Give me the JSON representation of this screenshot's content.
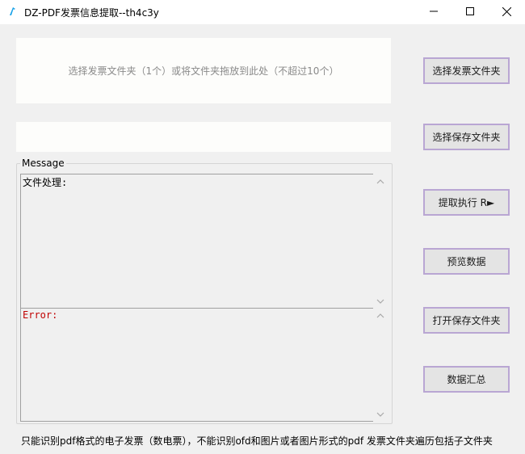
{
  "window": {
    "title": "DZ-PDF发票信息提取--th4c3y",
    "minimize_glyph": "—",
    "maximize_glyph": "☐",
    "close_glyph": "✕"
  },
  "drop_zone": {
    "text": "选择发票文件夹（1个）或将文件夹拖放到此处（不超过10个）"
  },
  "save_path": {
    "value": ""
  },
  "buttons": {
    "select_invoice_folder": "选择发票文件夹",
    "select_save_folder": "选择保存文件夹",
    "extract_run": "提取执行 R►",
    "preview_data": "预览数据",
    "open_save_folder": "打开保存文件夹",
    "data_summary": "数据汇总"
  },
  "message_group": {
    "legend": "Message",
    "file_log": "文件处理:",
    "error_log": "Error:"
  },
  "footer": {
    "text": "只能识别pdf格式的电子发票（数电票），不能识别ofd和图片或者图片形式的pdf    发票文件夹遍历包括子文件夹"
  },
  "colors": {
    "button_border": "#b9a6d3",
    "error_text": "#c00000",
    "app_icon": "#1aa3e8"
  },
  "icons": {
    "app": "app-icon",
    "scroll_up": "chevron-up-icon",
    "scroll_down": "chevron-down-icon"
  }
}
